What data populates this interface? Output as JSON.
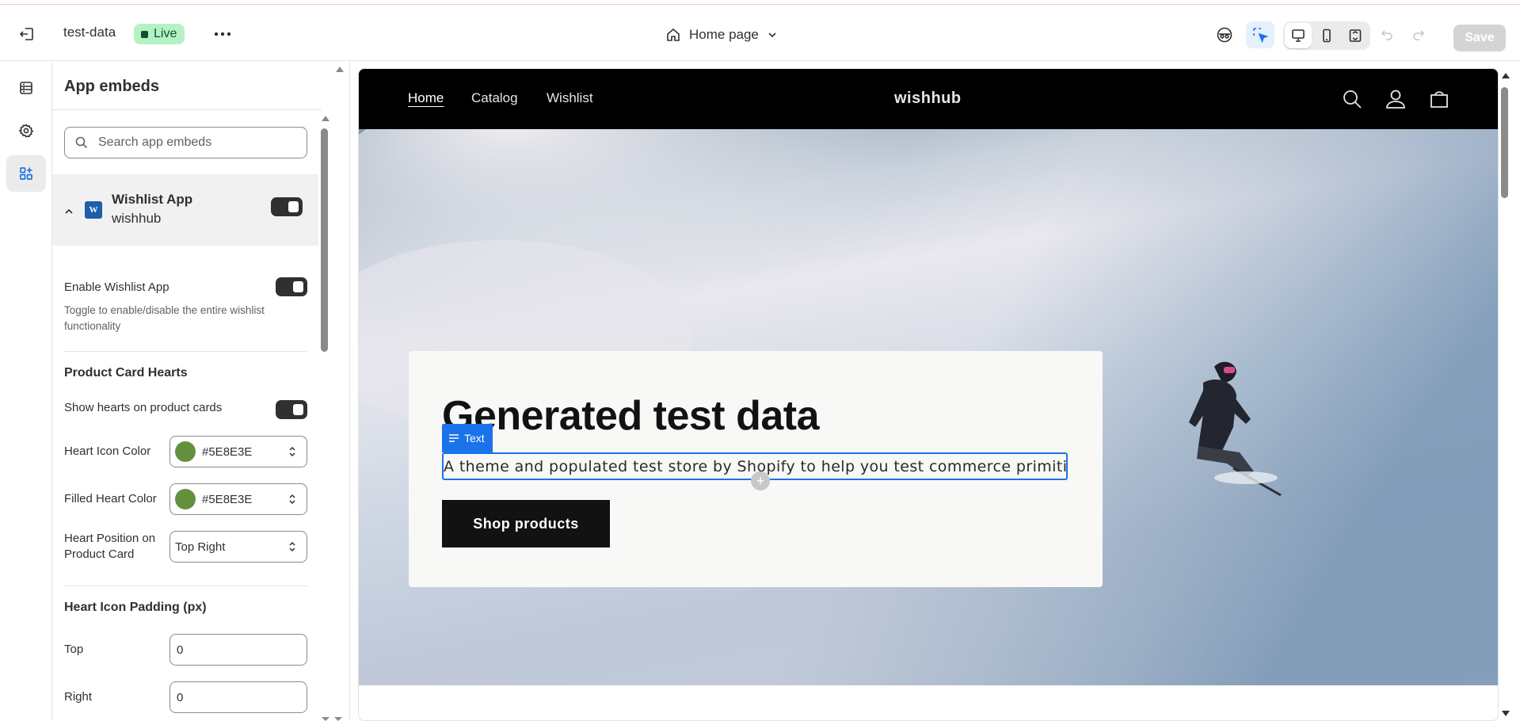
{
  "topbar": {
    "store_name": "test-data",
    "live_label": "Live",
    "page_selector": "Home page",
    "save_label": "Save"
  },
  "sidebar": {
    "title": "App embeds",
    "search_placeholder": "Search app embeds",
    "app": {
      "name": "Wishlist App",
      "vendor": "wishhub",
      "logo_letter": "W",
      "enabled": true
    },
    "enable_label": "Enable Wishlist App",
    "enable_help": "Toggle to enable/disable the entire wishlist functionality",
    "section_hearts": "Product Card Hearts",
    "show_hearts_label": "Show hearts on product cards",
    "heart_icon_color_label": "Heart Icon Color",
    "heart_icon_color_value": "#5E8E3E",
    "filled_heart_color_label": "Filled Heart Color",
    "filled_heart_color_value": "#5E8E3E",
    "heart_position_label": "Heart Position on Product Card",
    "heart_position_value": "Top Right",
    "section_padding": "Heart Icon Padding (px)",
    "padding_top_label": "Top",
    "padding_top_value": "0",
    "padding_right_label": "Right",
    "padding_right_value": "0"
  },
  "preview": {
    "nav": [
      "Home",
      "Catalog",
      "Wishlist"
    ],
    "brand": "wishhub",
    "hero_title": "Generated test data",
    "text_chip": "Text",
    "hero_text": "A theme and populated test store by Shopify to help you test commerce primitives.",
    "cta": "Shop products"
  },
  "colors": {
    "live_badge_bg": "#b5f2c3",
    "accent": "#1a73e8",
    "swatch": "#63903f"
  }
}
